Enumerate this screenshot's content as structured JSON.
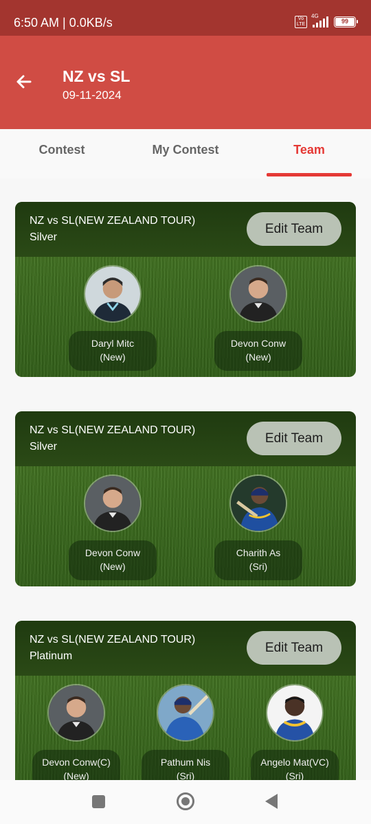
{
  "status_bar": {
    "time": "6:50 AM | 0.0KB/s",
    "volte_label": "Vo LTE",
    "network_label": "4G",
    "battery": "99"
  },
  "header": {
    "title": "NZ vs SL",
    "date": "09-11-2024",
    "back_icon": "arrow-left-icon"
  },
  "tabs": [
    {
      "label": "Contest",
      "active": false
    },
    {
      "label": "My Contest",
      "active": false
    },
    {
      "label": "Team",
      "active": true
    }
  ],
  "teams": [
    {
      "match": "NZ vs SL(NEW ZEALAND TOUR)",
      "tier": "Silver",
      "edit_label": "Edit Team",
      "players": [
        {
          "name": "Daryl Mitc",
          "team": "(New)"
        },
        {
          "name": "Devon Conw",
          "team": "(New)"
        }
      ]
    },
    {
      "match": "NZ vs SL(NEW ZEALAND TOUR)",
      "tier": "Silver",
      "edit_label": "Edit Team",
      "players": [
        {
          "name": "Devon Conw",
          "team": "(New)"
        },
        {
          "name": "Charith As",
          "team": "(Sri)"
        }
      ]
    },
    {
      "match": "NZ vs SL(NEW ZEALAND TOUR)",
      "tier": "Platinum",
      "edit_label": "Edit Team",
      "players": [
        {
          "name": "Devon Conw(C)",
          "team": "(New)"
        },
        {
          "name": "Pathum Nis",
          "team": "(Sri)"
        },
        {
          "name": "Angelo Mat(VC)",
          "team": "(Sri)"
        }
      ]
    }
  ],
  "colors": {
    "header_bg": "#d04c44",
    "status_bg": "#a3352f",
    "accent": "#e53935"
  }
}
